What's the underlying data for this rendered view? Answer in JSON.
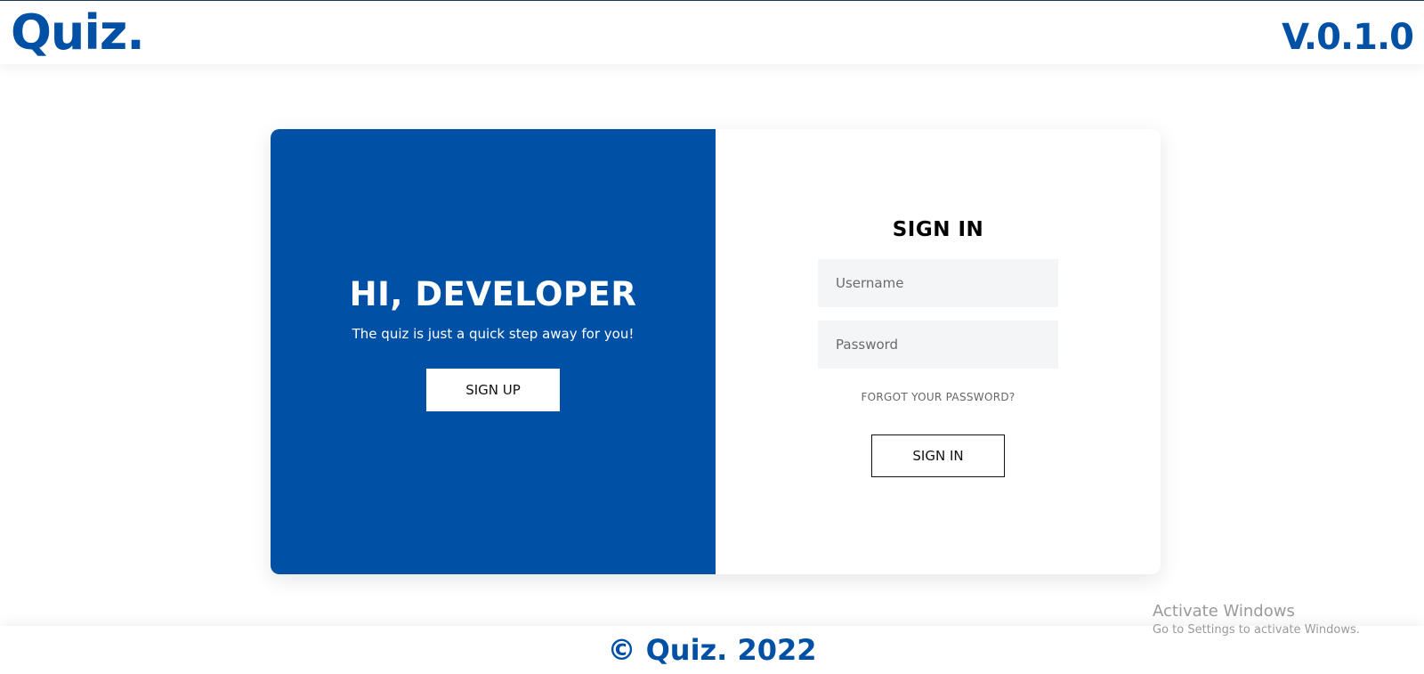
{
  "header": {
    "logo": "Quiz.",
    "version": "V.0.1.0"
  },
  "welcome": {
    "title": "HI, DEVELOPER",
    "tagline": "The quiz is just a quick step away for you!",
    "signup_label": "SIGN UP"
  },
  "signin": {
    "title": "SIGN IN",
    "username_placeholder": "Username",
    "password_placeholder": "Password",
    "forgot_label": "FORGOT YOUR PASSWORD?",
    "submit_label": "SIGN IN"
  },
  "footer": {
    "copyright": "© Quiz. 2022"
  },
  "watermark": {
    "title": "Activate Windows",
    "subtitle": "Go to Settings to activate Windows."
  },
  "colors": {
    "brand": "#0050a6",
    "field_bg": "#f4f5f7"
  }
}
